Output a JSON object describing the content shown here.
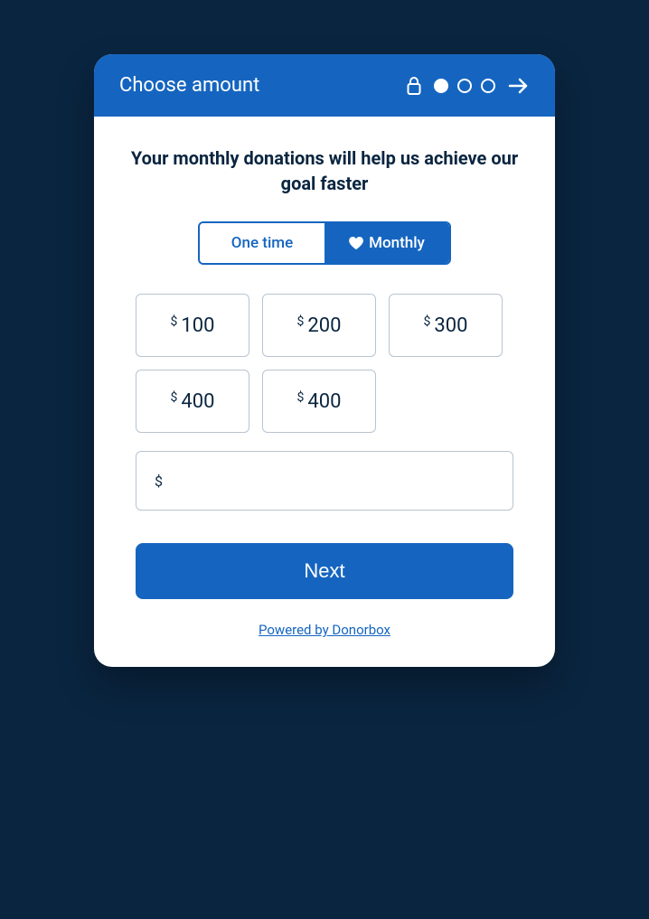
{
  "header": {
    "title": "Choose amount"
  },
  "main": {
    "heading": "Your monthly donations will help us achieve our goal faster",
    "frequency": {
      "onetime_label": "One time",
      "monthly_label": "Monthly"
    },
    "currency_symbol": "$",
    "amounts": [
      "100",
      "200",
      "300",
      "400",
      "400"
    ],
    "next_label": "Next"
  },
  "footer": {
    "powered_label": "Powered by Donorbox"
  }
}
